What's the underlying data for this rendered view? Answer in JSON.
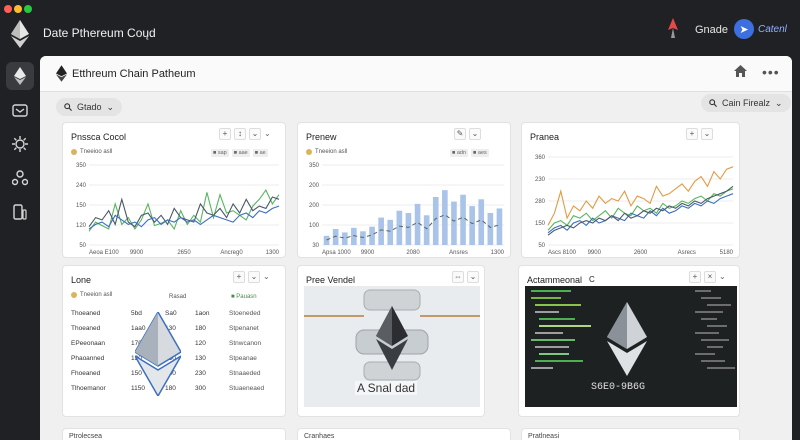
{
  "app": {
    "title": "Date Pthereum Coųd",
    "top_action_label": "Gnade",
    "connect_label": "Catenl"
  },
  "main": {
    "title": "Etthreum Chain Patheum",
    "filter_left": "Gtado",
    "filter_right": "Cain Firealz"
  },
  "cards": {
    "c1": {
      "title": "Pnssca Cocol",
      "legend": "Tneeioo asll",
      "chips": [
        "■ sap",
        "■ aae",
        "■ ae"
      ],
      "y_ticks": [
        "350",
        "240",
        "150",
        "120",
        "50"
      ],
      "x_ticks": [
        "Aeoa  E100",
        "9900",
        "2650",
        "Ancreg0",
        "1300"
      ]
    },
    "c2": {
      "title": "Prenew",
      "legend": "Tneeion asll",
      "chips": [
        "■ adn",
        "■ aes"
      ],
      "y_ticks": [
        "350",
        "200",
        "200",
        "100",
        "30"
      ],
      "x_ticks": [
        "Apsa  1000",
        "9900",
        "2080",
        "Ansres",
        "1300"
      ]
    },
    "c3": {
      "title": "Pranea",
      "y_ticks": [
        "360",
        "230",
        "280",
        "150",
        "50"
      ],
      "x_ticks": [
        "Ascs  8100",
        "9900",
        "2600",
        "Asrecs",
        "5180"
      ]
    },
    "c4": {
      "title": "Lone",
      "legend": "Tneeion asll",
      "col_a": "Rasad",
      "col_b": "■ Pauasn",
      "rows": [
        [
          "Thoeaned",
          "5bd",
          "Sa0",
          "1aon",
          "Stoeneded",
          "Sade"
        ],
        [
          "Thoeaned",
          "1aa0",
          "130",
          "180",
          "Stpenanet",
          "140"
        ],
        [
          "EPeeonaan",
          "170",
          "140",
          "120",
          "Stnwcanon",
          "120"
        ],
        [
          "Phaoanned",
          "130",
          "130",
          "130",
          "Stpeanae",
          "500"
        ],
        [
          "Fhoeaned",
          "150",
          "230",
          "230",
          "Stnaaeded",
          "600"
        ],
        [
          "Tlhoemanor",
          "1150",
          "180",
          "300",
          "Stuaeneaed",
          "810"
        ]
      ]
    },
    "c5": {
      "title": "Pree Vendel",
      "caption": "A Snal dad"
    },
    "c6": {
      "title": "Actammeonal",
      "suffix": "C",
      "caption": "S6E0-9B6G"
    },
    "bottom": [
      "Ptrolecsea",
      "Cranhaes",
      "Pratlneasi"
    ]
  },
  "colors": {
    "accent": "#3d6fe0",
    "series_green": "#59b560",
    "series_orange": "#e39a43",
    "series_blue": "#3b6fbf",
    "series_slate": "#4b5866",
    "bar_blue": "#a9c4e8"
  },
  "icons": {
    "sidebar": [
      "ethereum-icon",
      "cube-icon",
      "gear-icon",
      "network-icon",
      "device-icon"
    ]
  },
  "chart_data": [
    {
      "type": "line",
      "title": "Pnssca Cocol",
      "series": [
        {
          "name": "sap",
          "values": [
            60,
            100,
            85,
            70,
            180,
            90,
            120,
            70,
            110,
            180,
            85,
            95,
            110,
            70,
            150,
            90,
            130,
            100,
            230,
            120,
            220,
            140,
            150,
            130,
            110,
            170,
            200,
            240,
            180,
            220
          ]
        },
        {
          "name": "aae",
          "values": [
            80,
            120,
            110,
            150,
            90,
            200,
            100,
            80,
            130,
            140,
            100,
            130,
            90,
            160,
            120,
            110,
            100,
            180,
            140,
            130,
            160,
            120,
            180,
            140,
            200,
            150,
            170,
            160,
            210,
            200
          ]
        },
        {
          "name": "ae",
          "values": [
            70,
            90,
            100,
            80,
            130,
            110,
            90,
            100,
            80,
            110,
            120,
            90,
            110,
            100,
            120,
            100,
            110,
            90,
            110,
            130,
            120,
            110,
            100,
            130,
            140,
            120,
            150,
            140,
            160,
            170
          ]
        }
      ],
      "ylim": [
        0,
        350
      ]
    },
    {
      "type": "bar",
      "title": "Prenew",
      "values": [
        40,
        70,
        55,
        75,
        60,
        80,
        120,
        110,
        150,
        140,
        180,
        130,
        210,
        240,
        190,
        220,
        170,
        200,
        140,
        160
      ],
      "ylim": [
        0,
        350
      ]
    },
    {
      "type": "line",
      "title": "Pranea",
      "series": [
        {
          "values": [
            80,
            130,
            220,
            110,
            160,
            140,
            180,
            150,
            200,
            170,
            190,
            180,
            220,
            160,
            200,
            190,
            170,
            240,
            200,
            210,
            230,
            250,
            220,
            260,
            280,
            240,
            300,
            270,
            310,
            320
          ]
        },
        {
          "values": [
            60,
            90,
            100,
            80,
            120,
            110,
            130,
            100,
            120,
            140,
            110,
            150,
            130,
            120,
            160,
            140,
            150,
            130,
            170,
            150,
            160,
            180,
            170,
            190,
            200,
            180,
            210,
            200,
            220,
            230
          ]
        },
        {
          "values": [
            50,
            70,
            80,
            60,
            90,
            100,
            80,
            110,
            90,
            100,
            120,
            110,
            100,
            130,
            120,
            110,
            140,
            120,
            150,
            130,
            140,
            160,
            150,
            170,
            160,
            180,
            170,
            190,
            200,
            210
          ]
        },
        {
          "values": [
            40,
            60,
            70,
            80,
            70,
            90,
            100,
            90,
            110,
            100,
            120,
            100,
            130,
            110,
            120,
            140,
            130,
            150,
            140,
            160,
            150,
            170,
            160,
            180,
            170,
            190,
            200,
            210,
            220,
            240
          ]
        }
      ],
      "ylim": [
        0,
        360
      ]
    }
  ]
}
